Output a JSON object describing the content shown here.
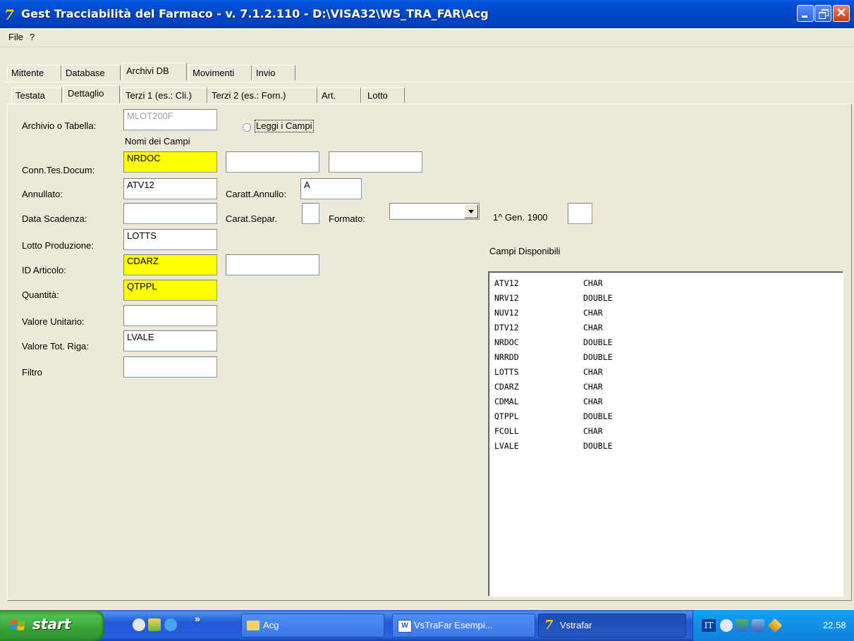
{
  "window": {
    "title": "Gest Tracciabilità del Farmaco - v. 7.1.2.110 - D:\\VISA32\\WS_TRA_FAR\\Acg",
    "icon_glyph": "7"
  },
  "menu": [
    "File",
    "?"
  ],
  "tabs_main": [
    "Mittente",
    "Database",
    "Archivi DB",
    "Movimenti",
    "Invio"
  ],
  "tabs_sub": [
    "Testata",
    "Dettaglio",
    "Terzi 1 (es.: Cli.)",
    "Terzi 2 (es.: Forn.)",
    "Art.",
    "Lotto"
  ],
  "form": {
    "archivio_label": "Archivio o Tabella:",
    "archivio_value": "MLOT200F",
    "leggi_label": "Leggi i Campi",
    "nomi_label": "Nomi dei Campi",
    "conn_label": "Conn.Tes.Docum:",
    "conn_value": "NRDOC",
    "conn_value2": "",
    "conn_value3": "",
    "annullato_label": "Annullato:",
    "annullato_value": "ATV12",
    "caratt_annullo_label": "Caratt.Annullo:",
    "caratt_annullo_value": "A",
    "data_scadenza_label": "Data Scadenza:",
    "data_scadenza_value": "",
    "carat_separ_label": "Carat.Separ.",
    "carat_separ_value": "",
    "formato_label": "Formato:",
    "formato_value": "",
    "gen1900_label": "1^ Gen. 1900",
    "gen1900_value": "",
    "lotto_label": "Lotto Produzione:",
    "lotto_value": "LOTTS",
    "id_articolo_label": "ID Articolo:",
    "id_articolo_value": "CDARZ",
    "id_articolo_value2": "",
    "quantita_label": "Quantità:",
    "quantita_value": "QTPPL",
    "valore_unitario_label": "Valore Unitario:",
    "valore_unitario_value": "",
    "valore_tot_label": "Valore Tot. Riga:",
    "valore_tot_value": "LVALE",
    "filtro_label": "Filtro",
    "filtro_value": ""
  },
  "campi": {
    "label": "Campi Disponibili",
    "rows": [
      {
        "name": "ATV12",
        "type": "CHAR"
      },
      {
        "name": "NRV12",
        "type": "DOUBLE"
      },
      {
        "name": "NUV12",
        "type": "CHAR"
      },
      {
        "name": "DTV12",
        "type": "CHAR"
      },
      {
        "name": "NRDOC",
        "type": "DOUBLE"
      },
      {
        "name": "NRRDD",
        "type": "DOUBLE"
      },
      {
        "name": "LOTTS",
        "type": "CHAR"
      },
      {
        "name": "CDARZ",
        "type": "CHAR"
      },
      {
        "name": "CDMAL",
        "type": "CHAR"
      },
      {
        "name": "QTPPL",
        "type": "DOUBLE"
      },
      {
        "name": "FCOLL",
        "type": "CHAR"
      },
      {
        "name": "LVALE",
        "type": "DOUBLE"
      }
    ]
  },
  "taskbar": {
    "start_label": "start",
    "chevron": "»",
    "buttons": [
      "Acg",
      "VsTraFar Esempi...",
      "Vstrafar"
    ],
    "lang": "IT",
    "clock": "22.58"
  },
  "colors": {
    "highlight_field": "#ffff00",
    "titlebar": "#0046c8",
    "window_bg": "#ece9d8"
  }
}
